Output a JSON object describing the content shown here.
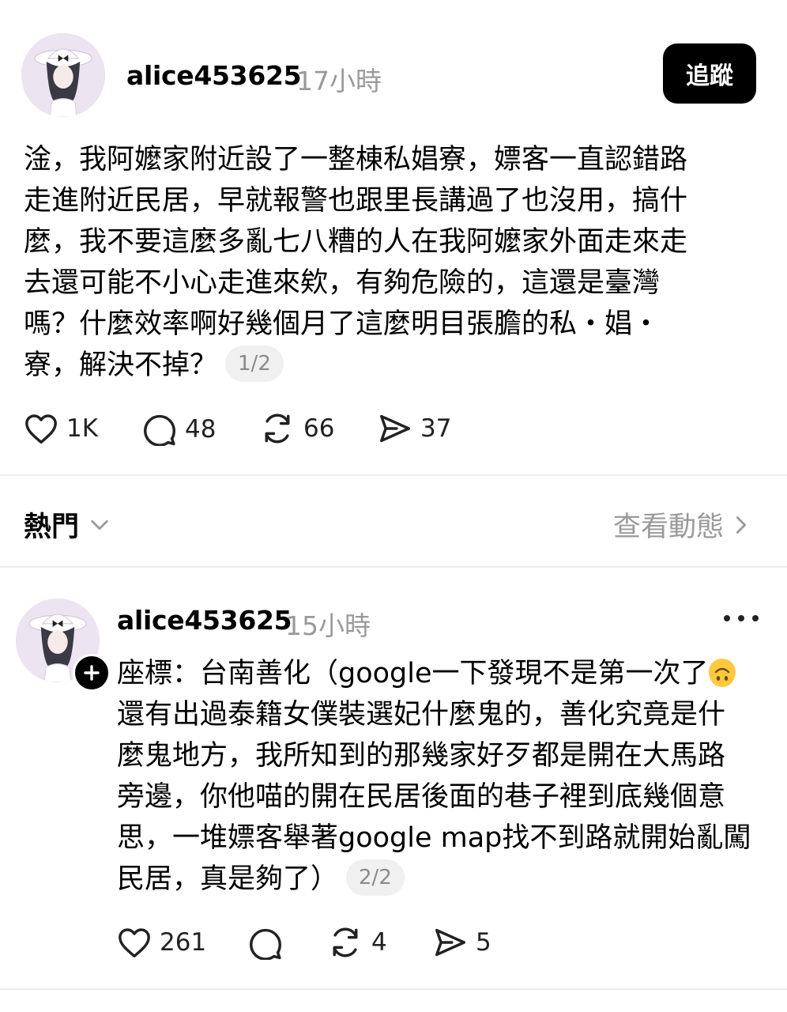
{
  "post1": {
    "username": "alice453625",
    "time": "17小時",
    "follow_label": "追蹤",
    "lines": [
      "淦，我阿嬤家附近設了一整棟私娼寮，嫖客一直認錯路",
      "走進附近民居，早就報警也跟里長講過了也沒用，搞什",
      "麼，我不要這麼多亂七八糟的人在我阿嬤家外面走來走",
      "去還可能不小心走進來欸，有夠危險的，這還是臺灣",
      "嗎？什麼效率啊好幾個月了這麼明目張膽的私・娼・",
      "寮，解決不掉？"
    ],
    "page_indicator": "1/2",
    "likes": "1K",
    "comments": "48",
    "reposts": "66",
    "shares": "37"
  },
  "section": {
    "title": "熱門",
    "view_activity": "查看動態"
  },
  "post2": {
    "username": "alice453625",
    "time": "15小時",
    "lines": [
      "座標：台南善化（google一下發現不是第一次了",
      "還有出過泰籍女僕裝選妃什麼鬼的，善化究竟是什",
      "麼鬼地方，我所知到的那幾家好歹都是開在大馬路",
      "旁邊，你他喵的開在民居後面的巷子裡到底幾個意",
      "思，一堆嫖客舉著google map找不到路就開始亂闖",
      "民居，真是夠了）"
    ],
    "page_indicator": "2/2",
    "likes": "261",
    "comments": "",
    "reposts": "4",
    "shares": "5"
  },
  "icons": {
    "like": "heart-icon",
    "comment": "comment-bubble-icon",
    "repost": "repost-icon",
    "share": "send-icon",
    "dropdown": "chevron-down-icon",
    "arrow": "chevron-right-icon",
    "more": "more-dots-icon",
    "emoji": "upside-down-face-emoji",
    "follow_badge": "plus-icon"
  }
}
